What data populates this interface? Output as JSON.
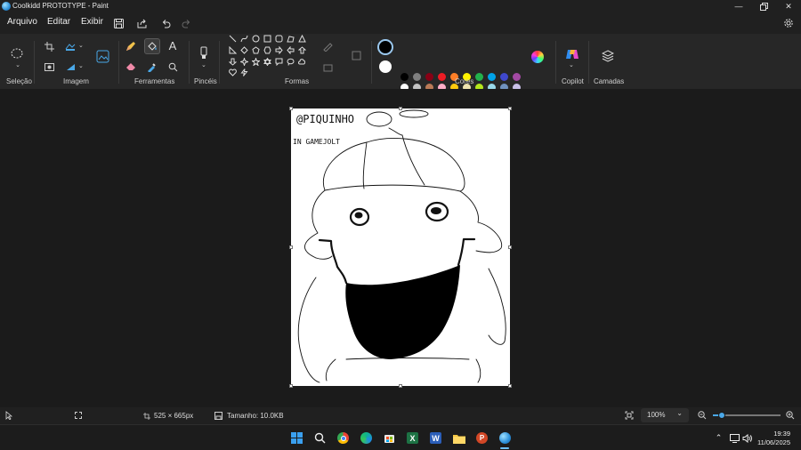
{
  "window": {
    "title": "Coolkidd PROTOTYPE - Paint",
    "minimize_icon": "minimize-icon",
    "maximize_icon": "restore-icon",
    "close_icon": "close-icon"
  },
  "menu": {
    "file": "Arquivo",
    "edit": "Editar",
    "view": "Exibir",
    "settings_icon": "gear-icon"
  },
  "ribbon": {
    "groups": {
      "selection": "Seleção",
      "image": "Imagem",
      "tools": "Ferramentas",
      "brushes": "Pincéis",
      "shapes": "Formas",
      "colors": "Cores",
      "copilot": "Copilot",
      "layers": "Camadas"
    },
    "colors": {
      "primary": "#000000",
      "secondary": "#ffffff",
      "palette_row1": [
        "#000000",
        "#7f7f7f",
        "#880015",
        "#ed1c24",
        "#ff7f27",
        "#fff200",
        "#22b14c",
        "#00a2e8",
        "#3f48cc",
        "#a349a4"
      ],
      "palette_row2": [
        "#ffffff",
        "#c3c3c3",
        "#b97a57",
        "#ffaec9",
        "#ffc90e",
        "#efe4b0",
        "#b5e61d",
        "#99d9ea",
        "#7092be",
        "#c8bfe7"
      ]
    }
  },
  "canvas": {
    "drawing_text_line1": "@PIQUINHO",
    "drawing_text_line2": "IN GAMEJOLT"
  },
  "status": {
    "canvas_size": "525 × 665px",
    "file_size": "Tamanho: 10.0KB",
    "zoom": "100%",
    "zoom_level": 0.125
  },
  "taskbar": {
    "time": "19:39",
    "date": "11/06/2025"
  }
}
